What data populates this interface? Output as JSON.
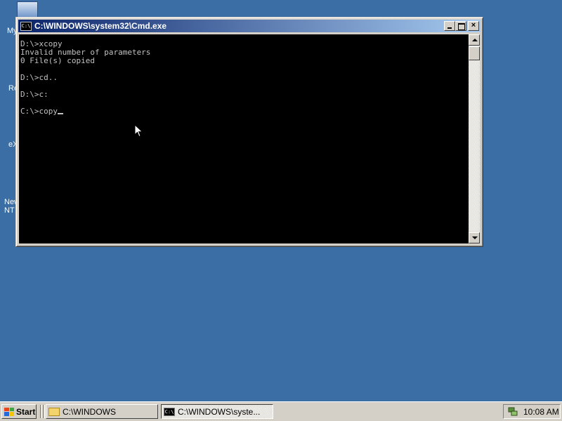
{
  "desktop": {
    "background_color": "#3a6ea5",
    "icons": [
      {
        "label": "My"
      },
      {
        "label": "Re"
      },
      {
        "label": "eX"
      },
      {
        "label": "New\nNT"
      }
    ]
  },
  "window": {
    "title": "C:\\WINDOWS\\system32\\Cmd.exe",
    "icon": "cmd-icon",
    "console_lines": "D:\\>xcopy\nInvalid number of parameters\n0 File(s) copied\n\nD:\\>cd..\n\nD:\\>c:\n\nC:\\>copy",
    "buttons": {
      "minimize": "minimize",
      "maximize": "maximize",
      "close": "×"
    }
  },
  "taskbar": {
    "start_label": "Start",
    "tasks": [
      {
        "label": "C:\\WINDOWS",
        "icon": "folder-icon",
        "active": false
      },
      {
        "label": "C:\\WINDOWS\\syste...",
        "icon": "cmd-icon",
        "active": true
      }
    ],
    "clock": "10:08 AM"
  },
  "colors": {
    "titlebar_start": "#0a246a",
    "titlebar_end": "#a6caf0",
    "console_text": "#c0c0c0"
  }
}
